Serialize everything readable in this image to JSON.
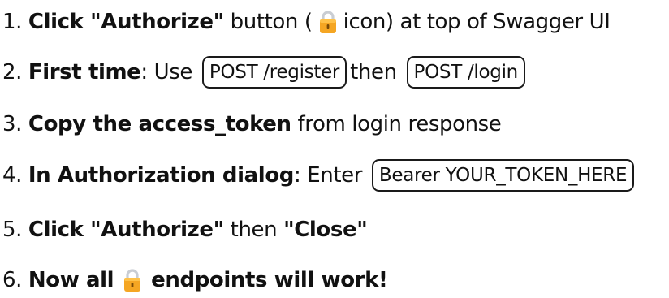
{
  "steps": [
    {
      "number": "1.",
      "bold": "Click \"Authorize\"",
      "text_a": "button (",
      "icon": "lock-icon",
      "text_b": "icon) at top of Swagger UI"
    },
    {
      "number": "2.",
      "bold": "First time",
      "text_a": ": Use",
      "code_1": "POST /register",
      "text_b": "then",
      "code_2": "POST /login"
    },
    {
      "number": "3.",
      "bold": "Copy the access_token",
      "text_a": "from login response"
    },
    {
      "number": "4.",
      "bold": "In Authorization dialog",
      "text_a": ": Enter",
      "code_1": "Bearer YOUR_TOKEN_HERE"
    },
    {
      "number": "5.",
      "bold": "Click \"Authorize\"",
      "text_a": "then",
      "bold_2": "\"Close\""
    },
    {
      "number": "6.",
      "bold": "Now all",
      "icon": "lock-icon",
      "bold_2": "endpoints will work!"
    }
  ],
  "colors": {
    "lock_body": "#F5A623",
    "lock_shackle": "#C9CDD3",
    "text": "#111111"
  }
}
